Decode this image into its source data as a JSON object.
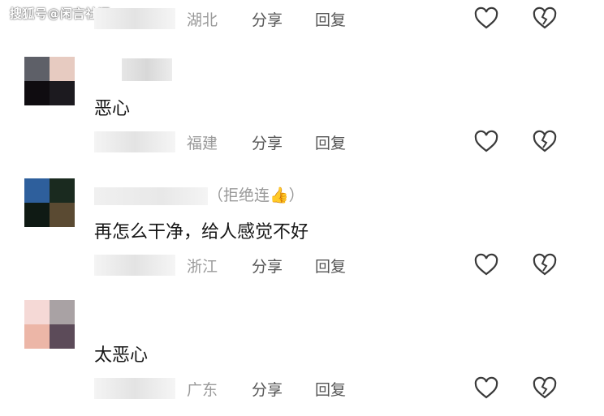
{
  "watermark": "搜狐号@闲言社评",
  "actions": {
    "share_label": "分享",
    "reply_label": "回复"
  },
  "icons": {
    "like": "heart-icon",
    "dislike": "broken-heart-icon"
  },
  "comments": [
    {
      "region": "湖北",
      "text": ""
    },
    {
      "region": "福建",
      "text": "恶心",
      "avatar": [
        "#5e6068",
        "#e7cbc1",
        "#0f0c10",
        "#1c1a1f"
      ]
    },
    {
      "region": "浙江",
      "text": "再怎么干净，给人感觉不好",
      "name_suffix": "（拒绝连👍）",
      "avatar": [
        "#2e5f9c",
        "#1a2a1f",
        "#0f1a14",
        "#5a4a32"
      ]
    },
    {
      "region": "广东",
      "text": "太恶心",
      "avatar": [
        "#f5d9d6",
        "#a9a2a4",
        "#ecb6a7",
        "#5c4b59"
      ]
    }
  ]
}
